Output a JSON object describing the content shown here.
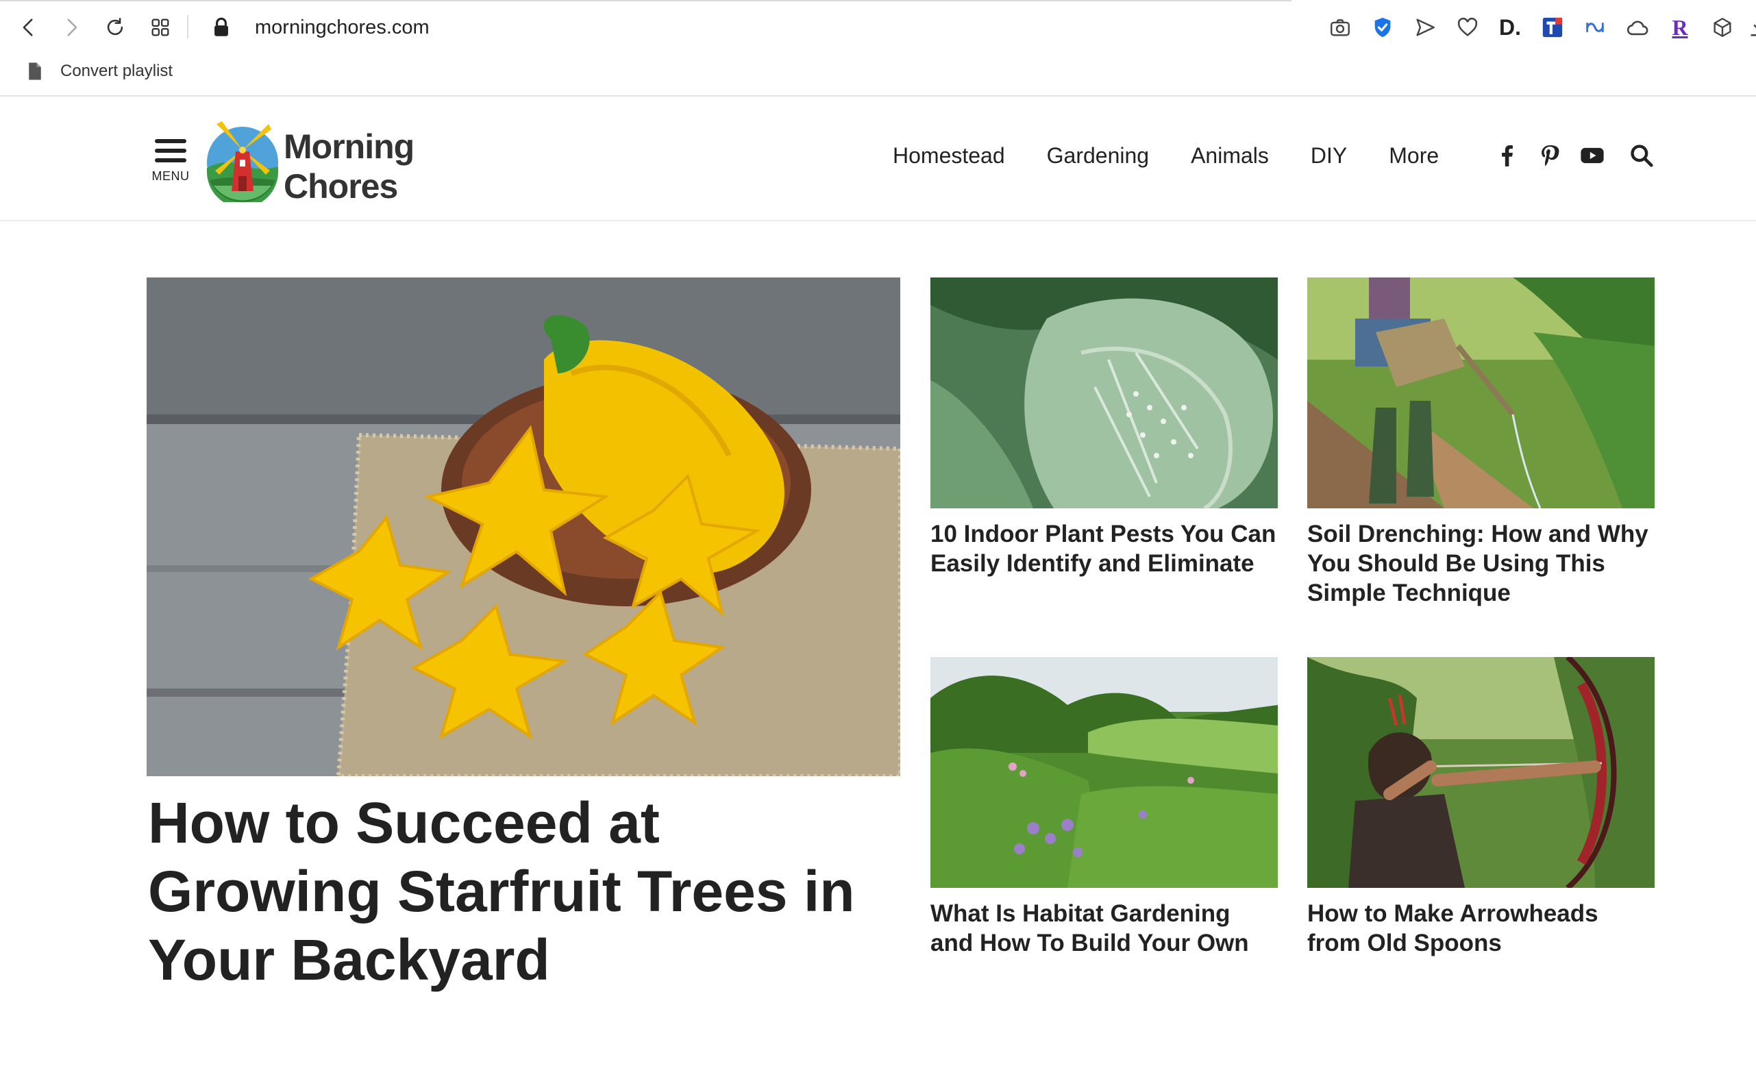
{
  "browser": {
    "url": "morningchores.com",
    "bookmark_label": "Convert playlist",
    "extensions": [
      "camera-icon",
      "shield-check-icon",
      "send-icon",
      "heart-icon",
      "d-extension-icon",
      "t-extension-icon",
      "translate-icon",
      "cloud-icon",
      "r-extension-icon",
      "cube-icon",
      "download-icon"
    ],
    "ext_d_label": "D.",
    "ext_r_label": "R"
  },
  "site": {
    "menu_label": "MENU",
    "logo_line1": "Morning",
    "logo_line2": "Chores",
    "nav": [
      "Homestead",
      "Gardening",
      "Animals",
      "DIY",
      "More"
    ],
    "social_icons": [
      "facebook-icon",
      "pinterest-icon",
      "youtube-icon",
      "search-icon"
    ]
  },
  "featured": {
    "title": "How to Succeed at Growing Starfruit Trees in Your Backyard",
    "image": "starfruit-photo"
  },
  "cards": [
    {
      "title": "10 Indoor Plant Pests You Can Easily Identify and Eliminate",
      "image": "plant-pests-photo"
    },
    {
      "title": "Soil Drenching: How and Why You Should Be Using This Simple Technique",
      "image": "watering-can-photo"
    },
    {
      "title": "What Is Habitat Gardening and How To Build Your Own",
      "image": "habitat-garden-photo"
    },
    {
      "title": "How to Make Arrowheads from Old Spoons",
      "image": "archer-photo"
    }
  ],
  "colors": {
    "text": "#222222",
    "link_blue": "#1a73e8",
    "logo_green": "#4caf50",
    "logo_red": "#d32f2f"
  }
}
